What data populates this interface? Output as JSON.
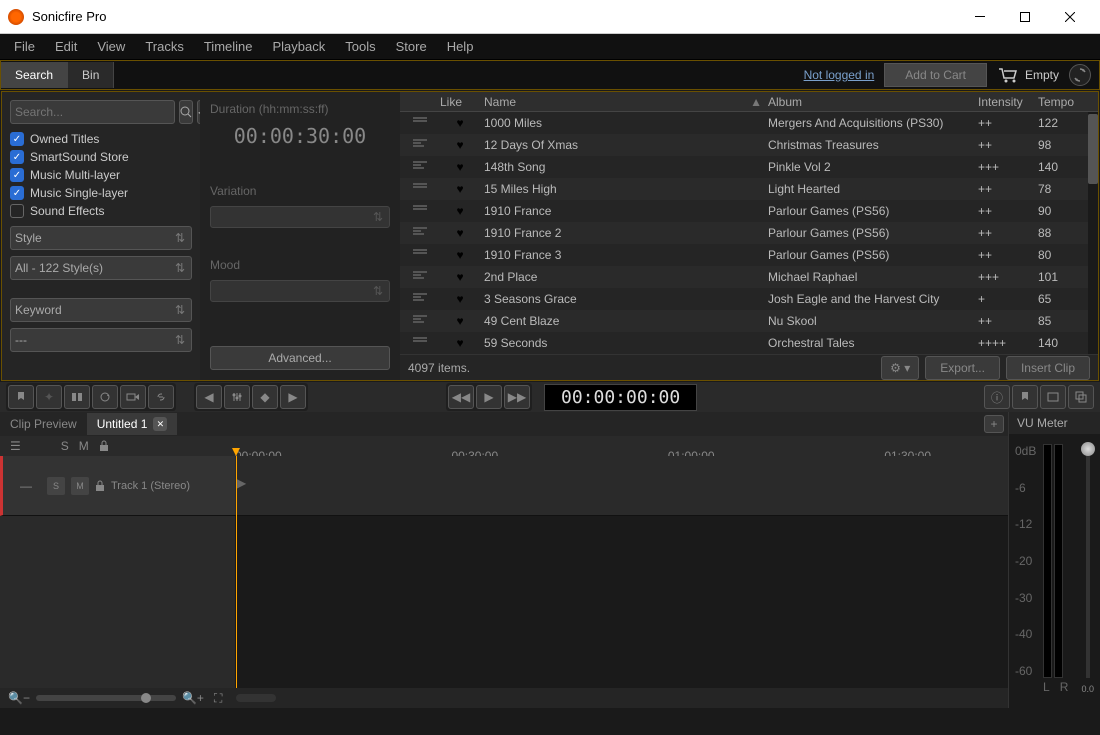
{
  "title": "Sonicfire Pro",
  "menu": [
    "File",
    "Edit",
    "View",
    "Tracks",
    "Timeline",
    "Playback",
    "Tools",
    "Store",
    "Help"
  ],
  "tabs": {
    "search": "Search",
    "bin": "Bin"
  },
  "header": {
    "login": "Not logged in",
    "addcart": "Add to Cart",
    "cartState": "Empty"
  },
  "search": {
    "placeholder": "Search..."
  },
  "filters": [
    {
      "label": "Owned Titles",
      "on": true
    },
    {
      "label": "SmartSound Store",
      "on": true
    },
    {
      "label": "Music Multi-layer",
      "on": true
    },
    {
      "label": "Music Single-layer",
      "on": true
    },
    {
      "label": "Sound Effects",
      "on": false
    }
  ],
  "selects": {
    "style": "Style",
    "styleAll": "All - 122 Style(s)",
    "keyword": "Keyword",
    "keywordAll": "---"
  },
  "mid": {
    "durLabel": "Duration (hh:mm:ss:ff)",
    "duration": "00:00:30:00",
    "variation": "Variation",
    "mood": "Mood",
    "advanced": "Advanced..."
  },
  "cols": {
    "like": "Like",
    "name": "Name",
    "album": "Album",
    "intensity": "Intensity",
    "tempo": "Tempo"
  },
  "rows": [
    {
      "name": "1000 Miles",
      "album": "Mergers And Acquisitions (PS30)",
      "int": "++",
      "tempo": "122",
      "bars": "v2"
    },
    {
      "name": "12 Days Of Xmas",
      "album": "Christmas Treasures",
      "int": "++",
      "tempo": "98",
      "bars": "v1"
    },
    {
      "name": "148th Song",
      "album": "Pinkle Vol 2",
      "int": "+++",
      "tempo": "140",
      "bars": "v1"
    },
    {
      "name": "15 Miles High",
      "album": "Light Hearted",
      "int": "++",
      "tempo": "78",
      "bars": "v2"
    },
    {
      "name": "1910 France",
      "album": "Parlour Games (PS56)",
      "int": "++",
      "tempo": "90",
      "bars": "v2"
    },
    {
      "name": "1910 France 2",
      "album": "Parlour Games (PS56)",
      "int": "++",
      "tempo": "88",
      "bars": "v1"
    },
    {
      "name": "1910 France 3",
      "album": "Parlour Games (PS56)",
      "int": "++",
      "tempo": "80",
      "bars": "v2"
    },
    {
      "name": "2nd Place",
      "album": "Michael Raphael",
      "int": "+++",
      "tempo": "101",
      "bars": "v1"
    },
    {
      "name": "3 Seasons Grace",
      "album": "Josh Eagle and the Harvest City",
      "int": "+",
      "tempo": "65",
      "bars": "v1"
    },
    {
      "name": "49 Cent Blaze",
      "album": "Nu Skool",
      "int": "++",
      "tempo": "85",
      "bars": "v1"
    },
    {
      "name": "59 Seconds",
      "album": "Orchestral Tales",
      "int": "++++",
      "tempo": "140",
      "bars": "v2"
    }
  ],
  "footer": {
    "count": "4097 items.",
    "export": "Export...",
    "insert": "Insert Clip"
  },
  "transport": {
    "timecode": "00:00:00:00"
  },
  "timeline": {
    "tabs": {
      "preview": "Clip Preview",
      "untitled": "Untitled 1"
    },
    "hdr": {
      "s": "S",
      "m": "M"
    },
    "ticks": [
      "00:00:00",
      "00:30:00",
      "01:00:00",
      "01:30:00"
    ],
    "track": {
      "name": "Track 1 (Stereo)",
      "s": "S",
      "m": "M"
    }
  },
  "vu": {
    "title": "VU Meter",
    "scale": [
      "0dB",
      "-6",
      "-12",
      "-20",
      "-30",
      "-40",
      "-60"
    ],
    "l": "L",
    "r": "R",
    "val": "0.0"
  },
  "zoom": {
    "out": "−",
    "in": "+"
  }
}
